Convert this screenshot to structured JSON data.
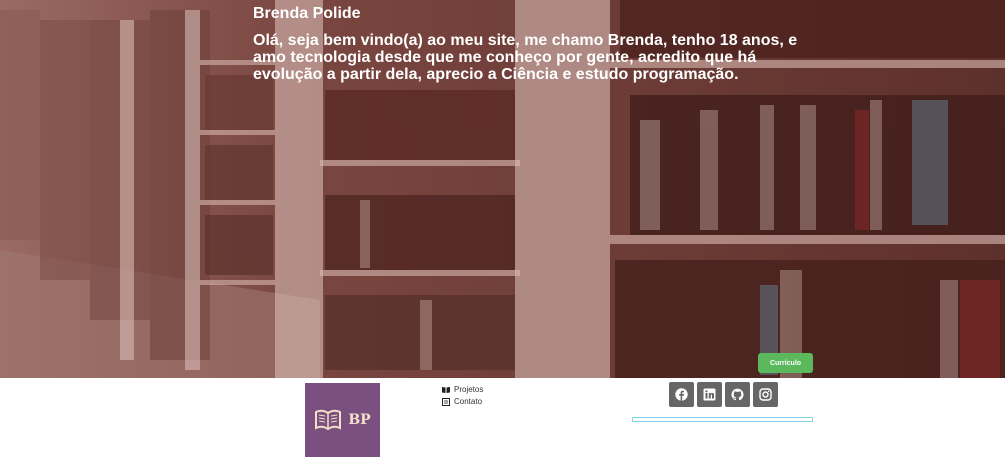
{
  "hero": {
    "name": "Brenda Polide",
    "intro": "Olá, seja bem vindo(a) ao meu site, me chamo Brenda, tenho 18 anos, e amo tecnologia desde que me conheço por gente, acredito que há evolução a partir dela, aprecio a Ciência e estudo programação.",
    "cv_button": "Currículo"
  },
  "logo": {
    "text": "BP",
    "icon": "book-icon",
    "background": "#7b4f80"
  },
  "nav": {
    "items": [
      {
        "label": "Projetos",
        "icon": "book-icon"
      },
      {
        "label": "Contato",
        "icon": "contact-icon"
      }
    ]
  },
  "social": {
    "items": [
      {
        "icon": "facebook-icon"
      },
      {
        "icon": "linkedin-icon"
      },
      {
        "icon": "github-icon"
      },
      {
        "icon": "instagram-icon"
      }
    ]
  },
  "colors": {
    "overlay": "#6b3a34",
    "button": "#5cb85c",
    "social": "#666666",
    "accent_line": "#7fd3e6"
  }
}
